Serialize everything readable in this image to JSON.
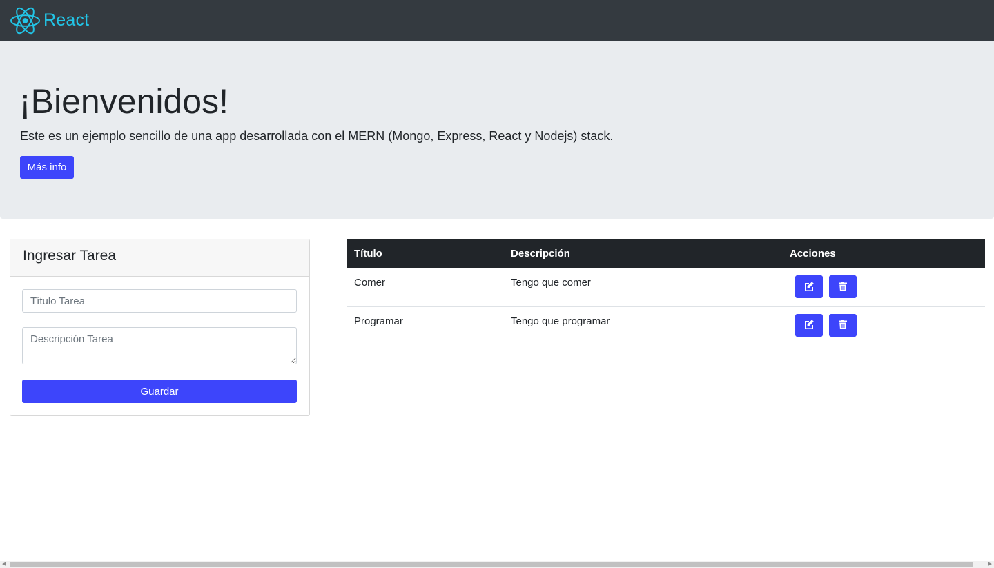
{
  "navbar": {
    "brand": "React",
    "brand_color": "#22c4e6",
    "logo_icon": "react-atom-icon"
  },
  "jumbotron": {
    "title": "¡Bienvenidos!",
    "lead": "Este es un ejemplo sencillo de una app desarrollada con el MERN (Mongo, Express, React y Nodejs) stack.",
    "button_label": "Más info"
  },
  "form": {
    "header": "Ingresar Tarea",
    "title_placeholder": "Título Tarea",
    "description_placeholder": "Descripción Tarea",
    "save_label": "Guardar"
  },
  "table": {
    "headers": [
      "Título",
      "Descripción",
      "Acciones"
    ],
    "rows": [
      {
        "title": "Comer",
        "description": "Tengo que comer",
        "actions": [
          "edit-icon",
          "trash-icon"
        ]
      },
      {
        "title": "Programar",
        "description": "Tengo que programar",
        "actions": [
          "edit-icon",
          "trash-icon"
        ]
      }
    ]
  },
  "colors": {
    "primary": "#3d45fb",
    "navbar": "#343a40",
    "jumbotron": "#e9ecef",
    "table_header": "#212529"
  }
}
